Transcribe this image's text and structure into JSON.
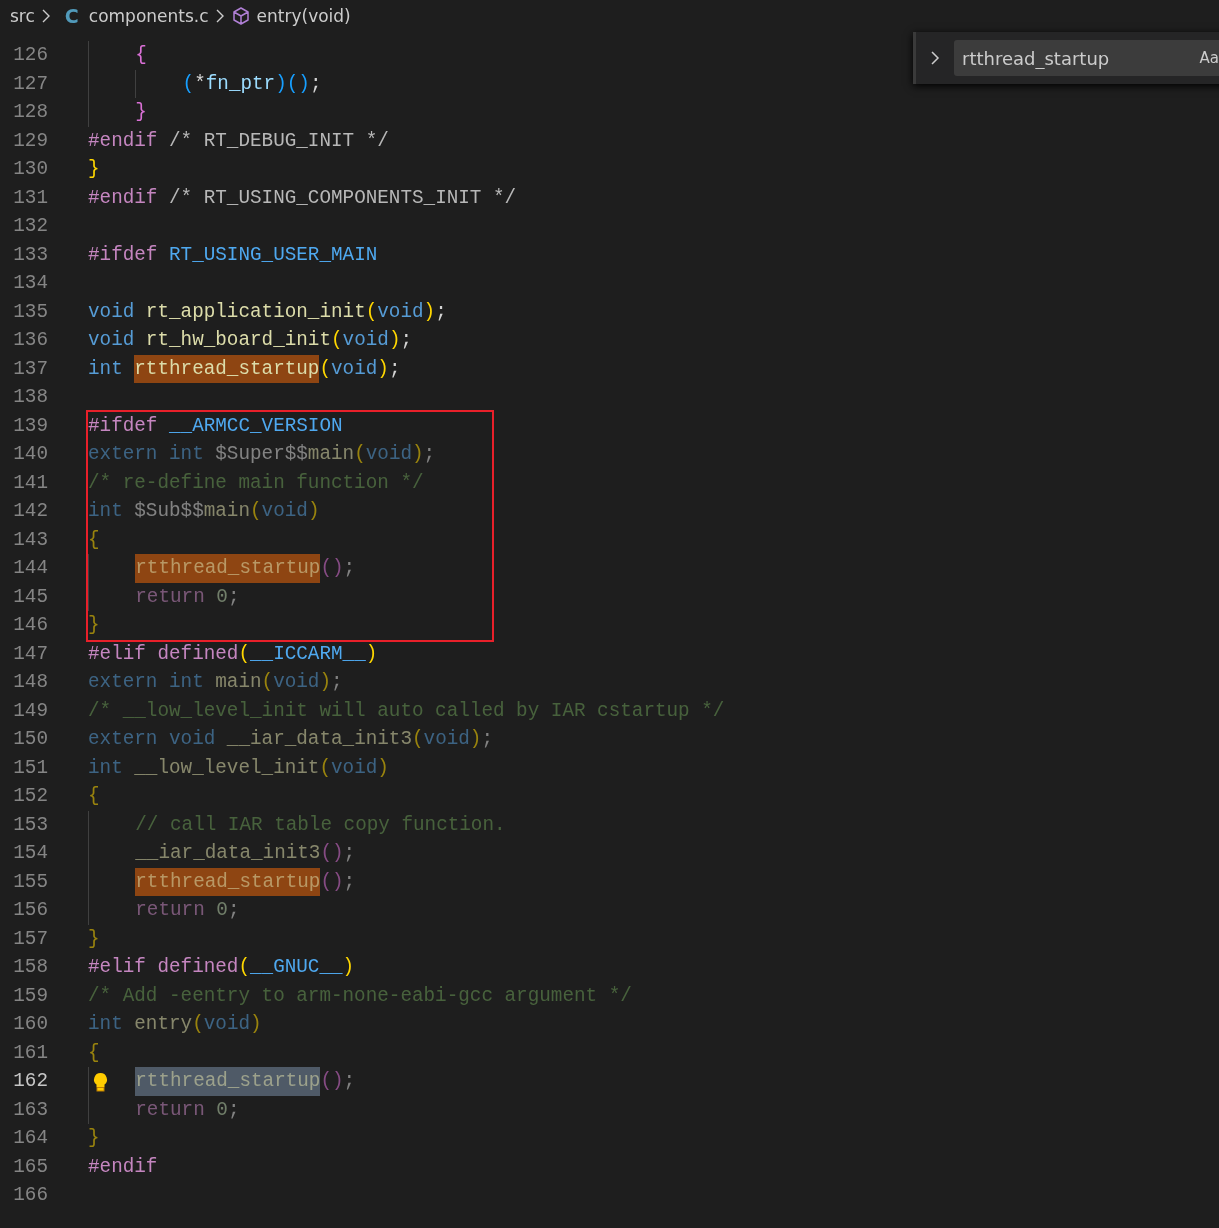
{
  "breadcrumb": {
    "folder": "src",
    "file_icon": "C",
    "file": "components.c",
    "symbol": "entry(void)"
  },
  "find_widget": {
    "value": "rtthread_startup",
    "match_case": "Aa"
  },
  "lines": [
    {
      "number": "126",
      "kind": "indented",
      "tokens": [
        {
          "t": "{",
          "kind": "p2"
        }
      ]
    },
    {
      "number": "127",
      "kind": "double_indented",
      "tokens": [
        {
          "t": "(",
          "kind": "p3"
        },
        {
          "t": "*",
          "kind": "plain"
        },
        {
          "t": "fn_ptr",
          "kind": "var"
        },
        {
          "t": ")()",
          "kind": "p3"
        },
        {
          "t": ";",
          "kind": "plain"
        }
      ]
    },
    {
      "number": "128",
      "kind": "indented",
      "tokens": [
        {
          "t": "}",
          "kind": "p2"
        }
      ]
    },
    {
      "number": "129",
      "tokens": [
        {
          "t": "#endif",
          "kind": "pp"
        },
        {
          "t": " /* RT_DEBUG_INIT */",
          "kind": "pc"
        }
      ]
    },
    {
      "number": "130",
      "tokens": [
        {
          "t": "}",
          "kind": "p1"
        }
      ]
    },
    {
      "number": "131",
      "tokens": [
        {
          "t": "#endif",
          "kind": "pp"
        },
        {
          "t": " /* RT_USING_COMPONENTS_INIT */",
          "kind": "pc"
        }
      ]
    },
    {
      "number": "132"
    },
    {
      "number": "133",
      "tokens": [
        {
          "t": "#ifdef",
          "kind": "pp"
        },
        {
          "t": " RT_USING_USER_MAIN",
          "kind": "mac"
        }
      ]
    },
    {
      "number": "134"
    },
    {
      "number": "135",
      "tokens": [
        {
          "t": "void",
          "kind": "kw"
        },
        {
          "t": " rt_application_init",
          "kind": "fn"
        },
        {
          "t": "(",
          "kind": "p1"
        },
        {
          "t": "void",
          "kind": "kw"
        },
        {
          "t": ")",
          "kind": "p1"
        },
        {
          "t": ";",
          "kind": "plain"
        }
      ]
    },
    {
      "number": "136",
      "tokens": [
        {
          "t": "void",
          "kind": "kw"
        },
        {
          "t": " rt_hw_board_init",
          "kind": "fn"
        },
        {
          "t": "(",
          "kind": "p1"
        },
        {
          "t": "void",
          "kind": "kw"
        },
        {
          "t": ")",
          "kind": "p1"
        },
        {
          "t": ";",
          "kind": "plain"
        }
      ]
    },
    {
      "number": "137",
      "tokens": [
        {
          "t": "int ",
          "kind": "kw"
        },
        {
          "t": "rtthread_startup",
          "kind": "fn",
          "match": true
        },
        {
          "t": "(",
          "kind": "p1"
        },
        {
          "t": "void",
          "kind": "kw"
        },
        {
          "t": ")",
          "kind": "p1"
        },
        {
          "t": ";",
          "kind": "plain"
        }
      ]
    },
    {
      "number": "138"
    },
    {
      "kind": "annotation_box",
      "lines": [
        {
          "number": "139",
          "tokens": [
            {
              "t": "#ifdef",
              "kind": "pp"
            },
            {
              "t": " __ARMCC_VERSION",
              "kind": "mac"
            }
          ]
        },
        {
          "number": "140",
          "inactive": true,
          "tokens": [
            {
              "t": "extern int",
              "kind": "kw"
            },
            {
              "t": " $Super$$",
              "kind": "plain"
            },
            {
              "t": "main",
              "kind": "fn"
            },
            {
              "t": "(",
              "kind": "p1"
            },
            {
              "t": "void",
              "kind": "kw"
            },
            {
              "t": ")",
              "kind": "p1"
            },
            {
              "t": ";",
              "kind": "plain"
            }
          ]
        },
        {
          "number": "141",
          "inactive": true,
          "tokens": [
            {
              "t": "/* re-define main function */",
              "kind": "cm"
            }
          ]
        },
        {
          "number": "142",
          "inactive": true,
          "tokens": [
            {
              "t": "int",
              "kind": "kw"
            },
            {
              "t": " $Sub$$",
              "kind": "plain"
            },
            {
              "t": "main",
              "kind": "fn"
            },
            {
              "t": "(",
              "kind": "p1"
            },
            {
              "t": "void",
              "kind": "kw"
            },
            {
              "t": ")",
              "kind": "p1"
            }
          ]
        },
        {
          "number": "143",
          "inactive": true,
          "tokens": [
            {
              "t": "{",
              "kind": "p1"
            }
          ]
        },
        {
          "number": "144",
          "inactive": true,
          "kind": "indented",
          "tokens": [
            {
              "t": "rtthread_startup",
              "kind": "fn",
              "match": true
            },
            {
              "t": "()",
              "kind": "p2"
            },
            {
              "t": ";",
              "kind": "plain"
            }
          ]
        },
        {
          "number": "145",
          "inactive": true,
          "kind": "indented",
          "tokens": [
            {
              "t": "return",
              "kind": "ret"
            },
            {
              "t": " 0",
              "kind": "num"
            },
            {
              "t": ";",
              "kind": "plain"
            }
          ]
        },
        {
          "number": "146",
          "inactive": true,
          "tokens": [
            {
              "t": "}",
              "kind": "p1"
            }
          ]
        }
      ]
    },
    {
      "number": "147",
      "tokens": [
        {
          "t": "#elif defined",
          "kind": "pp"
        },
        {
          "t": "(",
          "kind": "p1"
        },
        {
          "t": "__ICCARM__",
          "kind": "mac"
        },
        {
          "t": ")",
          "kind": "p1"
        }
      ]
    },
    {
      "number": "148",
      "inactive": true,
      "tokens": [
        {
          "t": "extern int",
          "kind": "kw"
        },
        {
          "t": " main",
          "kind": "fn"
        },
        {
          "t": "(",
          "kind": "p1"
        },
        {
          "t": "void",
          "kind": "kw"
        },
        {
          "t": ")",
          "kind": "p1"
        },
        {
          "t": ";",
          "kind": "plain"
        }
      ]
    },
    {
      "number": "149",
      "inactive": true,
      "tokens": [
        {
          "t": "/* __low_level_init will auto called by IAR cstartup */",
          "kind": "cm"
        }
      ]
    },
    {
      "number": "150",
      "inactive": true,
      "tokens": [
        {
          "t": "extern void",
          "kind": "kw"
        },
        {
          "t": " __iar_data_init3",
          "kind": "fn"
        },
        {
          "t": "(",
          "kind": "p1"
        },
        {
          "t": "void",
          "kind": "kw"
        },
        {
          "t": ")",
          "kind": "p1"
        },
        {
          "t": ";",
          "kind": "plain"
        }
      ]
    },
    {
      "number": "151",
      "inactive": true,
      "tokens": [
        {
          "t": "int",
          "kind": "kw"
        },
        {
          "t": " __low_level_init",
          "kind": "fn"
        },
        {
          "t": "(",
          "kind": "p1"
        },
        {
          "t": "void",
          "kind": "kw"
        },
        {
          "t": ")",
          "kind": "p1"
        }
      ]
    },
    {
      "number": "152",
      "inactive": true,
      "tokens": [
        {
          "t": "{",
          "kind": "p1"
        }
      ]
    },
    {
      "number": "153",
      "inactive": true,
      "kind": "indented",
      "tokens": [
        {
          "t": "// call IAR table copy function.",
          "kind": "cm"
        }
      ]
    },
    {
      "number": "154",
      "inactive": true,
      "kind": "indented",
      "tokens": [
        {
          "t": "__iar_data_init3",
          "kind": "fn"
        },
        {
          "t": "()",
          "kind": "p2"
        },
        {
          "t": ";",
          "kind": "plain"
        }
      ]
    },
    {
      "number": "155",
      "inactive": true,
      "kind": "indented",
      "tokens": [
        {
          "t": "rtthread_startup",
          "kind": "fn",
          "match": true
        },
        {
          "t": "()",
          "kind": "p2"
        },
        {
          "t": ";",
          "kind": "plain"
        }
      ]
    },
    {
      "number": "156",
      "inactive": true,
      "kind": "indented",
      "tokens": [
        {
          "t": "return",
          "kind": "ret"
        },
        {
          "t": " 0",
          "kind": "num"
        },
        {
          "t": ";",
          "kind": "plain"
        }
      ]
    },
    {
      "number": "157",
      "inactive": true,
      "tokens": [
        {
          "t": "}",
          "kind": "p1"
        }
      ]
    },
    {
      "number": "158",
      "tokens": [
        {
          "t": "#elif defined",
          "kind": "pp"
        },
        {
          "t": "(",
          "kind": "p1"
        },
        {
          "t": "__GNUC__",
          "kind": "mac"
        },
        {
          "t": ")",
          "kind": "p1"
        }
      ]
    },
    {
      "number": "159",
      "inactive": true,
      "tokens": [
        {
          "t": "/* Add -eentry to arm-none-eabi-gcc argument */",
          "kind": "cm"
        }
      ]
    },
    {
      "number": "160",
      "inactive": true,
      "tokens": [
        {
          "t": "int",
          "kind": "kw"
        },
        {
          "t": " entry",
          "kind": "fn"
        },
        {
          "t": "(",
          "kind": "p1"
        },
        {
          "t": "void",
          "kind": "kw"
        },
        {
          "t": ")",
          "kind": "p1"
        }
      ]
    },
    {
      "number": "161",
      "inactive": true,
      "tokens": [
        {
          "t": "{",
          "kind": "p1"
        }
      ]
    },
    {
      "number": "162",
      "inactive": true,
      "current": true,
      "lightbulb": true,
      "kind": "indented",
      "tokens": [
        {
          "t": "rtthread_startup",
          "kind": "fn",
          "selected": true
        },
        {
          "t": "()",
          "kind": "p2"
        },
        {
          "t": ";",
          "kind": "plain"
        }
      ]
    },
    {
      "number": "163",
      "inactive": true,
      "kind": "indented",
      "tokens": [
        {
          "t": "return",
          "kind": "ret"
        },
        {
          "t": " 0",
          "kind": "num"
        },
        {
          "t": ";",
          "kind": "plain"
        }
      ]
    },
    {
      "number": "164",
      "inactive": true,
      "tokens": [
        {
          "t": "}",
          "kind": "p1"
        }
      ]
    },
    {
      "number": "165",
      "tokens": [
        {
          "t": "#endif",
          "kind": "pp"
        }
      ]
    },
    {
      "number": "166"
    }
  ]
}
